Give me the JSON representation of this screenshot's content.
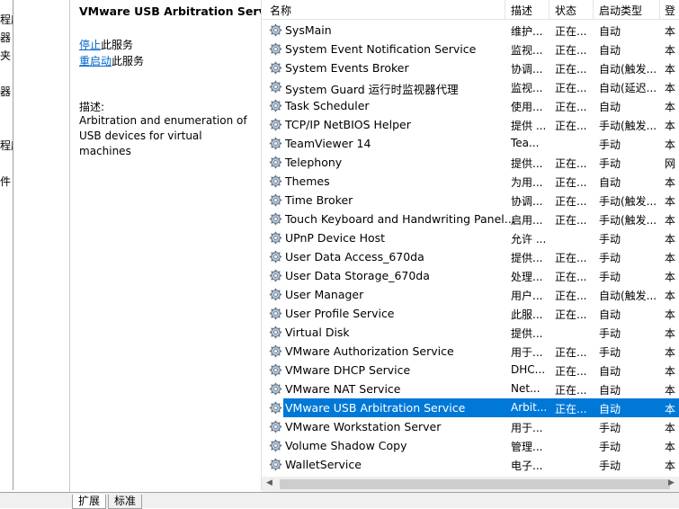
{
  "tree": [
    "程序",
    "器",
    "夹",
    "器",
    "程序",
    "件"
  ],
  "details": {
    "title": "VMware USB Arbitration Service",
    "stop_link": "停止",
    "stop_suffix": "此服务",
    "restart_link": "重启动",
    "restart_suffix": "此服务",
    "desc_label": "描述:",
    "desc_text": "Arbitration and enumeration of USB devices for virtual machines"
  },
  "columns": {
    "name": "名称",
    "desc": "描述",
    "status": "状态",
    "startup": "启动类型",
    "login": "登"
  },
  "services": [
    {
      "name": "SysMain",
      "desc": "维护...",
      "status": "正在...",
      "startup": "自动",
      "login": "本"
    },
    {
      "name": "System Event Notification Service",
      "desc": "监视...",
      "status": "正在...",
      "startup": "自动",
      "login": "本"
    },
    {
      "name": "System Events Broker",
      "desc": "协调...",
      "status": "正在...",
      "startup": "自动(触发...",
      "login": "本"
    },
    {
      "name": "System Guard 运行时监视器代理",
      "desc": "监视...",
      "status": "正在...",
      "startup": "自动(延迟...",
      "login": "本"
    },
    {
      "name": "Task Scheduler",
      "desc": "使用...",
      "status": "正在...",
      "startup": "自动",
      "login": "本"
    },
    {
      "name": "TCP/IP NetBIOS Helper",
      "desc": "提供 ...",
      "status": "正在...",
      "startup": "手动(触发...",
      "login": "本"
    },
    {
      "name": "TeamViewer 14",
      "desc": "Tea...",
      "status": "",
      "startup": "手动",
      "login": "本"
    },
    {
      "name": "Telephony",
      "desc": "提供...",
      "status": "正在...",
      "startup": "手动",
      "login": "网"
    },
    {
      "name": "Themes",
      "desc": "为用...",
      "status": "正在...",
      "startup": "自动",
      "login": "本"
    },
    {
      "name": "Time Broker",
      "desc": "协调...",
      "status": "正在...",
      "startup": "手动(触发...",
      "login": "本"
    },
    {
      "name": "Touch Keyboard and Handwriting Panel...",
      "desc": "启用...",
      "status": "正在...",
      "startup": "手动(触发...",
      "login": "本"
    },
    {
      "name": "UPnP Device Host",
      "desc": "允许 ...",
      "status": "",
      "startup": "手动",
      "login": "本"
    },
    {
      "name": "User Data Access_670da",
      "desc": "提供...",
      "status": "正在...",
      "startup": "手动",
      "login": "本"
    },
    {
      "name": "User Data Storage_670da",
      "desc": "处理...",
      "status": "正在...",
      "startup": "手动",
      "login": "本"
    },
    {
      "name": "User Manager",
      "desc": "用户...",
      "status": "正在...",
      "startup": "自动(触发...",
      "login": "本"
    },
    {
      "name": "User Profile Service",
      "desc": "此服...",
      "status": "正在...",
      "startup": "自动",
      "login": "本"
    },
    {
      "name": "Virtual Disk",
      "desc": "提供...",
      "status": "",
      "startup": "手动",
      "login": "本"
    },
    {
      "name": "VMware Authorization Service",
      "desc": "用于...",
      "status": "正在...",
      "startup": "手动",
      "login": "本"
    },
    {
      "name": "VMware DHCP Service",
      "desc": "DHC...",
      "status": "正在...",
      "startup": "自动",
      "login": "本"
    },
    {
      "name": "VMware NAT Service",
      "desc": "Net...",
      "status": "正在...",
      "startup": "自动",
      "login": "本"
    },
    {
      "name": "VMware USB Arbitration Service",
      "desc": "Arbit...",
      "status": "正在...",
      "startup": "自动",
      "login": "本",
      "selected": true
    },
    {
      "name": "VMware Workstation Server",
      "desc": "用于...",
      "status": "",
      "startup": "手动",
      "login": "本"
    },
    {
      "name": "Volume Shadow Copy",
      "desc": "管理...",
      "status": "",
      "startup": "手动",
      "login": "本"
    },
    {
      "name": "WalletService",
      "desc": "电子...",
      "status": "",
      "startup": "手动",
      "login": "本"
    }
  ],
  "tabs": [
    "扩展",
    "标准"
  ],
  "colors": {
    "selection": "#0078d7",
    "link": "#0066cc"
  }
}
